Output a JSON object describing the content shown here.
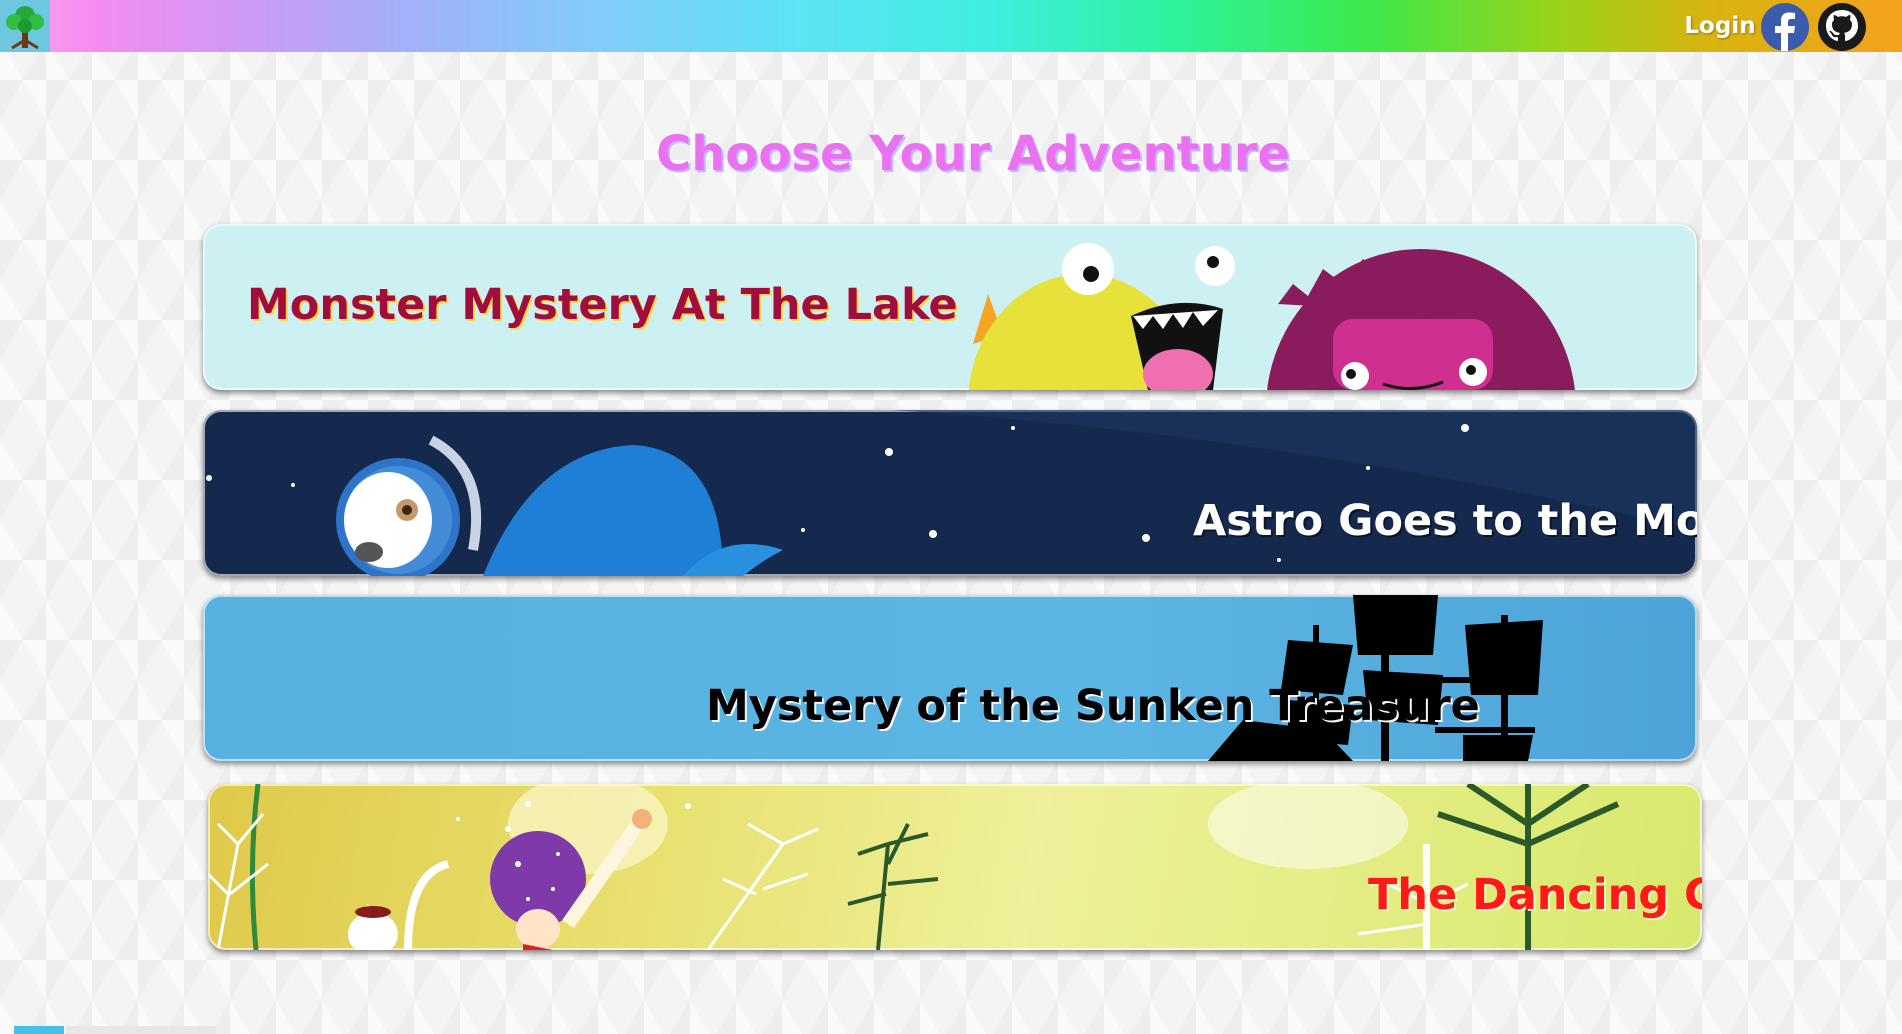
{
  "header": {
    "logo_icon": "tree-icon",
    "login_label": "Login",
    "social": [
      {
        "name": "facebook",
        "icon": "facebook-icon"
      },
      {
        "name": "github",
        "icon": "github-icon"
      }
    ],
    "gradient_colors": [
      "#f6a6ee",
      "#c79cf8",
      "#80cdfb",
      "#3feee0",
      "#3ce84a",
      "#d9b30f",
      "#f3a21e"
    ]
  },
  "main": {
    "title": "Choose Your Adventure",
    "adventures": [
      {
        "title": "Monster Mystery At The Lake",
        "background": "#cdf0f2",
        "title_color": "#a10d3c"
      },
      {
        "title": "Astro Goes to the Moon",
        "background": "#15284d",
        "title_color": "#ffffff"
      },
      {
        "title": "Mystery of the Sunken Treasure",
        "background": "#56b0e0",
        "title_color": "#000000"
      },
      {
        "title": "The Dancing Cat",
        "background": "#e8e170",
        "title_color": "#ff1a1a"
      }
    ]
  }
}
